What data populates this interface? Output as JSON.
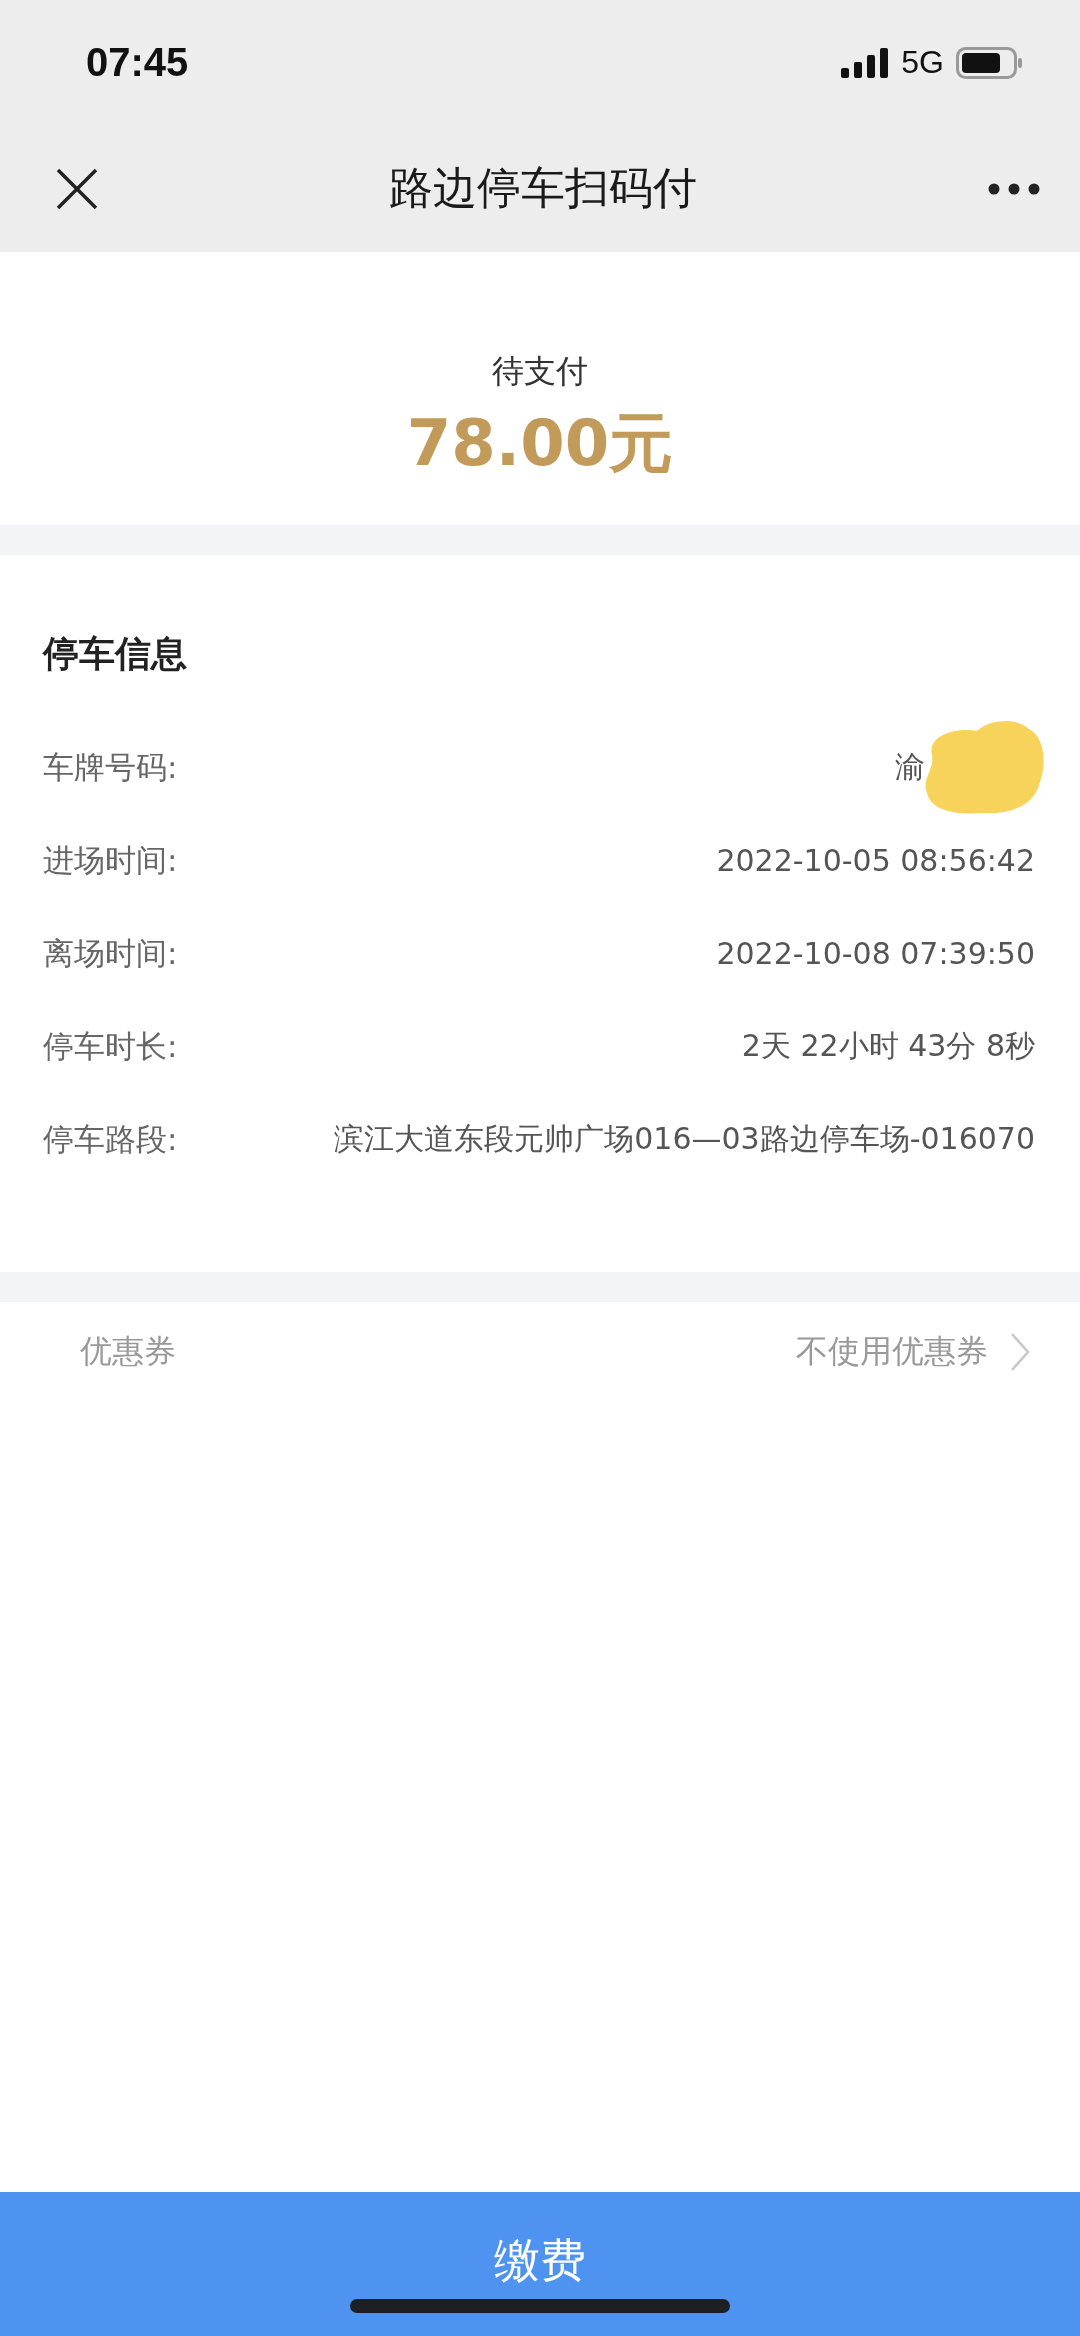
{
  "status_bar": {
    "time": "07:45",
    "network": "5G"
  },
  "nav_bar": {
    "title": "路边停车扫码付"
  },
  "payment": {
    "label": "待支付",
    "amount": "78.00元"
  },
  "parking_info": {
    "title": "停车信息",
    "rows": [
      {
        "label": "车牌号码:",
        "value": "渝",
        "redacted": true
      },
      {
        "label": "进场时间:",
        "value": "2022-10-05 08:56:42",
        "redacted": false
      },
      {
        "label": "离场时间:",
        "value": "2022-10-08 07:39:50",
        "redacted": false
      },
      {
        "label": "停车时长:",
        "value": "2天 22小时 43分 8秒",
        "redacted": false
      },
      {
        "label": "停车路段:",
        "value": "滨江大道东段元帅广场016—03路边停车场-016070",
        "redacted": false
      }
    ]
  },
  "coupon": {
    "label": "优惠券",
    "value": "不使用优惠券"
  },
  "pay_button": {
    "label": "缴费"
  }
}
